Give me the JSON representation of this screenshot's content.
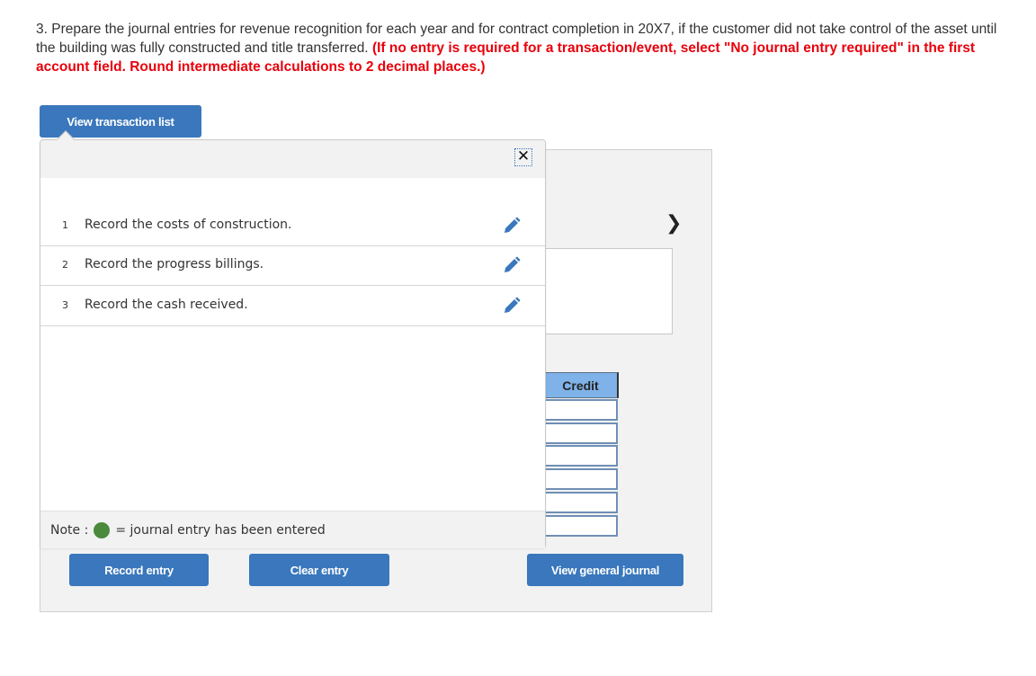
{
  "question": {
    "text": "3. Prepare the journal entries for revenue recognition for each year and for contract completion in 20X7, if the customer did not take control of the asset until the building was fully constructed and title transferred. ",
    "instruction": "(If no entry is required for a transaction/event, select \"No journal entry required\" in the first account field. Round intermediate calculations to 2 decimal places.)"
  },
  "buttons": {
    "view_transaction_list": "View transaction list",
    "record_entry": "Record entry",
    "clear_entry": "Clear entry",
    "view_general_journal": "View general journal"
  },
  "popup": {
    "close_icon": "close-icon",
    "transactions": [
      {
        "num": "1",
        "label": "Record the costs of construction.",
        "icon": "pencil-icon"
      },
      {
        "num": "2",
        "label": "Record the progress billings.",
        "icon": "pencil-icon"
      },
      {
        "num": "3",
        "label": "Record the cash received.",
        "icon": "pencil-icon"
      }
    ],
    "note_prefix": "Note :",
    "note_suffix": "= journal entry has been entered",
    "note_dot_color": "#4a8a3d"
  },
  "journal": {
    "credit_header": "Credit",
    "next_icon": "chevron-right-icon",
    "credit_values": [
      "",
      "",
      "",
      "",
      "",
      ""
    ]
  },
  "colors": {
    "accent": "#3a77bc",
    "instruction_red": "#e8000b",
    "header_blue": "#7fb2e8"
  }
}
